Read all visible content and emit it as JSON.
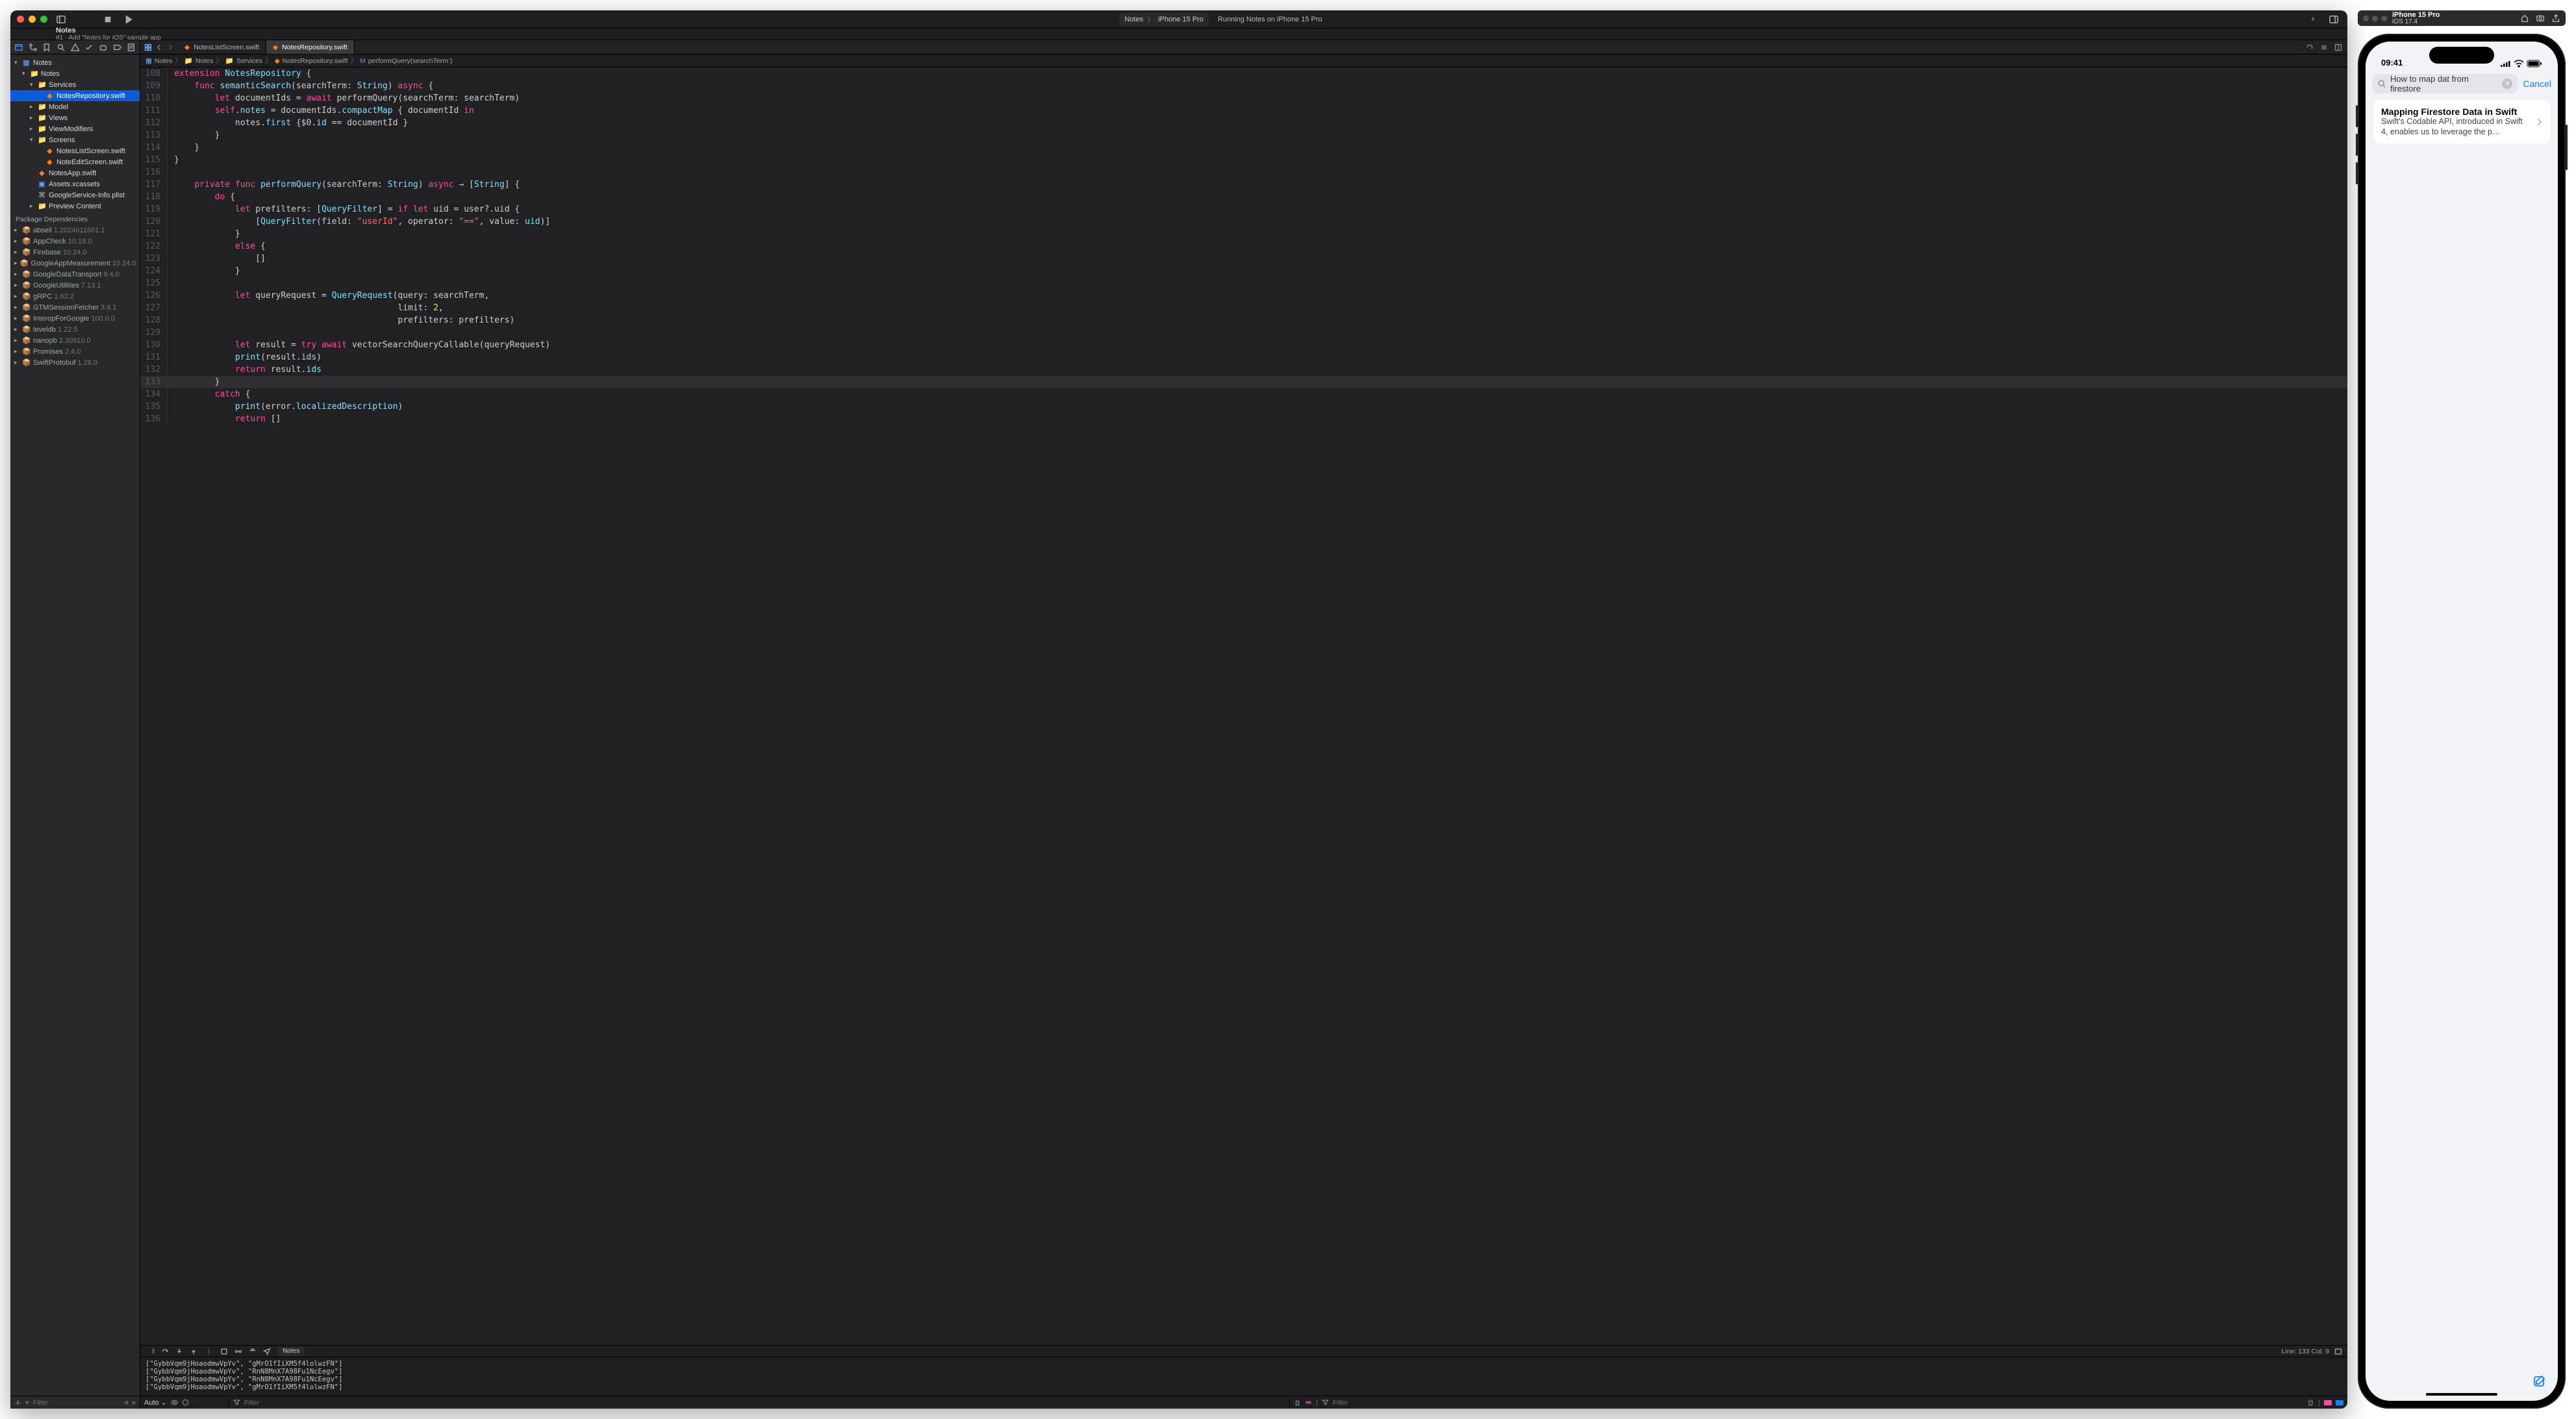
{
  "xcode": {
    "title": "Notes",
    "subtitle": "#1 · Add \"Notes for iOS\" sample app",
    "scheme": {
      "target": "Notes",
      "device": "iPhone 15 Pro"
    },
    "status": "Running Notes on iPhone 15 Pro",
    "navigator": {
      "project": "Notes",
      "groups": [
        {
          "name": "Notes",
          "children": [
            {
              "name": "Services",
              "children": [
                {
                  "name": "NotesRepository.swift",
                  "selected": true,
                  "swift": true
                }
              ]
            },
            {
              "name": "Model",
              "collapsed": true
            },
            {
              "name": "Views",
              "collapsed": true
            },
            {
              "name": "ViewModifiers",
              "collapsed": true
            },
            {
              "name": "Screens",
              "children": [
                {
                  "name": "NotesListScreen.swift",
                  "swift": true
                },
                {
                  "name": "NoteEditScreen.swift",
                  "swift": true
                }
              ]
            },
            {
              "name": "NotesApp.swift",
              "swift": true
            },
            {
              "name": "Assets.xcassets",
              "assets": true
            },
            {
              "name": "GoogleService-Info.plist",
              "plist": true
            },
            {
              "name": "Preview Content",
              "collapsed": true
            }
          ]
        }
      ],
      "depsHeader": "Package Dependencies",
      "deps": [
        {
          "name": "abseil",
          "ver": "1.2024011601.1"
        },
        {
          "name": "AppCheck",
          "ver": "10.19.0"
        },
        {
          "name": "Firebase",
          "ver": "10.24.0"
        },
        {
          "name": "GoogleAppMeasurement",
          "ver": "10.24.0"
        },
        {
          "name": "GoogleDataTransport",
          "ver": "9.4.0"
        },
        {
          "name": "GoogleUtilities",
          "ver": "7.13.1"
        },
        {
          "name": "gRPC",
          "ver": "1.62.2"
        },
        {
          "name": "GTMSessionFetcher",
          "ver": "3.4.1"
        },
        {
          "name": "InteropForGoogle",
          "ver": "100.0.0"
        },
        {
          "name": "leveldb",
          "ver": "1.22.5"
        },
        {
          "name": "nanopb",
          "ver": "2.30910.0"
        },
        {
          "name": "Promises",
          "ver": "2.4.0"
        },
        {
          "name": "SwiftProtobuf",
          "ver": "1.26.0"
        }
      ],
      "filterPlaceholder": "Filter"
    },
    "tabs": [
      {
        "label": "NotesListScreen.swift"
      },
      {
        "label": "NotesRepository.swift",
        "active": true
      }
    ],
    "jumpbar": [
      "Notes",
      "Notes",
      "Services",
      "NotesRepository.swift",
      "performQuery(searchTerm:)"
    ],
    "code": {
      "firstLine": 108,
      "lines": [
        [
          {
            "t": "extension ",
            "c": "kw"
          },
          {
            "t": "NotesRepository",
            "c": "typ"
          },
          {
            "t": " {"
          }
        ],
        [
          {
            "t": "    func ",
            "c": "kw"
          },
          {
            "t": "semanticSearch",
            "c": "fn"
          },
          {
            "t": "(searchTerm: "
          },
          {
            "t": "String",
            "c": "typ"
          },
          {
            "t": ") "
          },
          {
            "t": "async",
            "c": "kw"
          },
          {
            "t": " {"
          }
        ],
        [
          {
            "t": "        let",
            "c": "kw"
          },
          {
            "t": " documentIds = "
          },
          {
            "t": "await",
            "c": "kw"
          },
          {
            "t": " performQuery(searchTerm: searchTerm)"
          }
        ],
        [
          {
            "t": "        self",
            "c": "kw"
          },
          {
            "t": "."
          },
          {
            "t": "notes",
            "c": "prop"
          },
          {
            "t": " = documentIds."
          },
          {
            "t": "compactMap",
            "c": "fn"
          },
          {
            "t": " { documentId "
          },
          {
            "t": "in",
            "c": "kw"
          }
        ],
        [
          {
            "t": "            notes."
          },
          {
            "t": "first",
            "c": "fn"
          },
          {
            "t": " {$0."
          },
          {
            "t": "id",
            "c": "prop"
          },
          {
            "t": " == documentId }"
          }
        ],
        [
          {
            "t": "        }"
          }
        ],
        [
          {
            "t": "    }"
          }
        ],
        [
          {
            "t": "}"
          }
        ],
        [
          {
            "t": ""
          }
        ],
        [
          {
            "t": "    private func ",
            "c": "kw"
          },
          {
            "t": "performQuery",
            "c": "fn"
          },
          {
            "t": "(searchTerm: "
          },
          {
            "t": "String",
            "c": "typ"
          },
          {
            "t": ") "
          },
          {
            "t": "async",
            "c": "kw"
          },
          {
            "t": " → ["
          },
          {
            "t": "String",
            "c": "typ"
          },
          {
            "t": "] {"
          }
        ],
        [
          {
            "t": "        do",
            "c": "kw"
          },
          {
            "t": " {"
          }
        ],
        [
          {
            "t": "            let",
            "c": "kw"
          },
          {
            "t": " prefilters: ["
          },
          {
            "t": "QueryFilter",
            "c": "typ"
          },
          {
            "t": "] = "
          },
          {
            "t": "if let",
            "c": "kw"
          },
          {
            "t": " uid = user?.uid {"
          }
        ],
        [
          {
            "t": "                ["
          },
          {
            "t": "QueryFilter",
            "c": "typ"
          },
          {
            "t": "(field: "
          },
          {
            "t": "\"userId\"",
            "c": "str"
          },
          {
            "t": ", operator: "
          },
          {
            "t": "\"==\"",
            "c": "str"
          },
          {
            "t": ", value: "
          },
          {
            "t": "uid",
            "c": "prop"
          },
          {
            "t": ")]"
          }
        ],
        [
          {
            "t": "            }"
          }
        ],
        [
          {
            "t": "            else",
            "c": "kw"
          },
          {
            "t": " {"
          }
        ],
        [
          {
            "t": "                []"
          }
        ],
        [
          {
            "t": "            }"
          }
        ],
        [
          {
            "t": ""
          }
        ],
        [
          {
            "t": "            let",
            "c": "kw"
          },
          {
            "t": " queryRequest = "
          },
          {
            "t": "QueryRequest",
            "c": "typ"
          },
          {
            "t": "(query: searchTerm,"
          }
        ],
        [
          {
            "t": "                                            limit: "
          },
          {
            "t": "2",
            "c": "num"
          },
          {
            "t": ","
          }
        ],
        [
          {
            "t": "                                            prefilters: prefilters)"
          }
        ],
        [
          {
            "t": "            "
          }
        ],
        [
          {
            "t": "            let",
            "c": "kw"
          },
          {
            "t": " result = "
          },
          {
            "t": "try await",
            "c": "kw"
          },
          {
            "t": " vectorSearchQueryCallable(queryRequest)"
          }
        ],
        [
          {
            "t": "            "
          },
          {
            "t": "print",
            "c": "fn"
          },
          {
            "t": "(result."
          },
          {
            "t": "ids",
            "c": "prop"
          },
          {
            "t": ")"
          }
        ],
        [
          {
            "t": "            return",
            "c": "kw"
          },
          {
            "t": " result."
          },
          {
            "t": "ids",
            "c": "prop"
          }
        ],
        [
          {
            "t": "        }"
          }
        ],
        [
          {
            "t": "        catch",
            "c": "kw"
          },
          {
            "t": " {"
          }
        ],
        [
          {
            "t": "            "
          },
          {
            "t": "print",
            "c": "fn"
          },
          {
            "t": "(error."
          },
          {
            "t": "localizedDescription",
            "c": "prop"
          },
          {
            "t": ")"
          }
        ],
        [
          {
            "t": "            return",
            "c": "kw"
          },
          {
            "t": " []"
          }
        ]
      ],
      "highlightLine": 133
    },
    "statusLine": {
      "pos": "Line: 133  Col: 9"
    },
    "debug": {
      "scheme": "Notes",
      "auto": "Auto ⌄",
      "filter1": "Filter",
      "filter2": "Filter"
    },
    "console": [
      "[\"GybbVqm9jHoaodmwVpYv\", \"gMrO1fIiXM5f4lolwzFN\"]",
      "[\"GybbVqm9jHoaodmwVpYv\", \"RnN8MnX7A98Fu1NcEegv\"]",
      "[\"GybbVqm9jHoaodmwVpYv\", \"RnN8MnX7A98Fu1NcEegv\"]",
      "[\"GybbVqm9jHoaodmwVpYv\", \"gMrO1fIiXM5f4lolwzFN\"]"
    ]
  },
  "sim": {
    "titlebar": {
      "name": "iPhone 15 Pro",
      "os": "iOS 17.4"
    },
    "status": {
      "time": "09:41"
    },
    "search": {
      "text": "How to map dat from firestore",
      "cancel": "Cancel"
    },
    "result": {
      "title": "Mapping Firestore Data in Swift",
      "subtitle": "Swift's Codable API, introduced in Swift 4, enables us to leverage the p…"
    }
  }
}
